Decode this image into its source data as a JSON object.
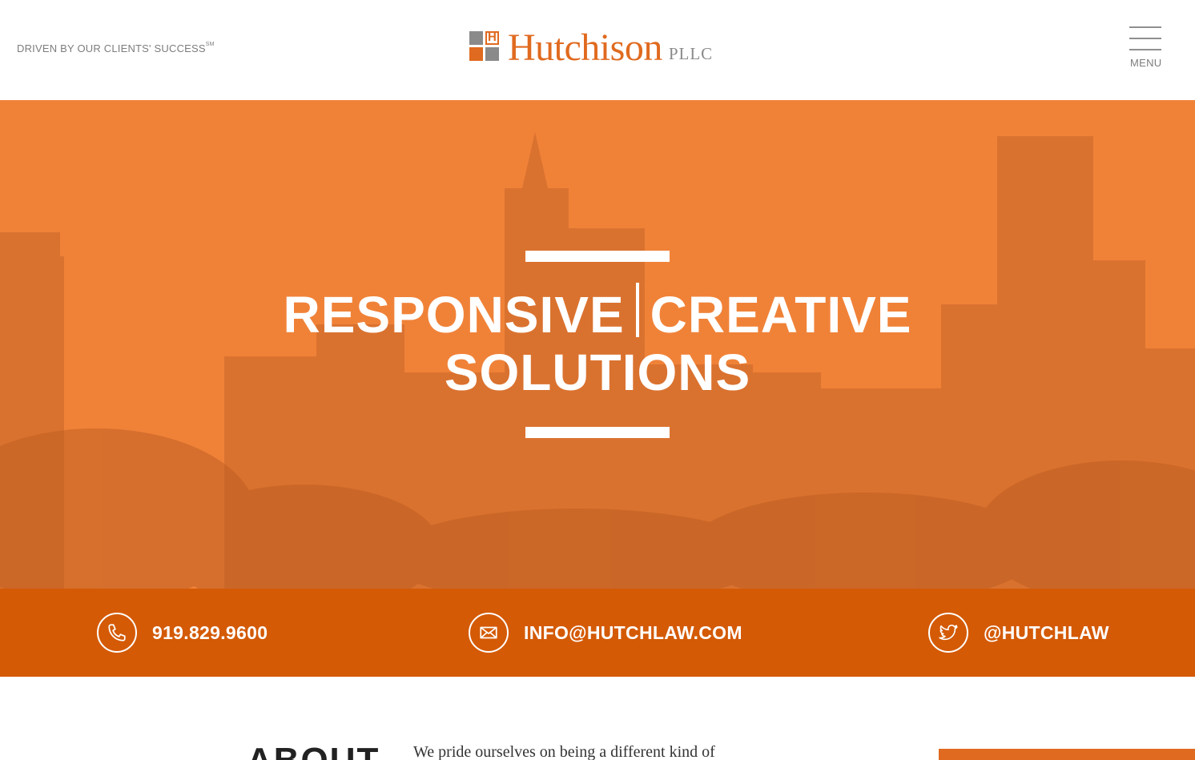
{
  "header": {
    "tagline": "DRIVEN BY OUR CLIENTS' SUCCESS",
    "tagline_mark": "SM",
    "logo_letter": "H",
    "logo_name": "Hutchison",
    "logo_suffix": "PLLC",
    "menu_label": "MENU"
  },
  "hero": {
    "line1_left": "RESPONSIVE",
    "line1_right": "CREATIVE",
    "line2": "SOLUTIONS"
  },
  "contact": {
    "phone": "919.829.9600",
    "email": "INFO@HUTCHLAW.COM",
    "twitter": "@HUTCHLAW"
  },
  "about": {
    "heading": "ABOUT",
    "intro": "We pride ourselves on being a different kind of"
  },
  "colors": {
    "brand_orange": "#e06a1f",
    "hero_orange": "#f08238",
    "contact_bar": "#d45a06",
    "gray": "#8a8a8a"
  },
  "icons": [
    "phone-icon",
    "envelope-icon",
    "twitter-icon"
  ]
}
